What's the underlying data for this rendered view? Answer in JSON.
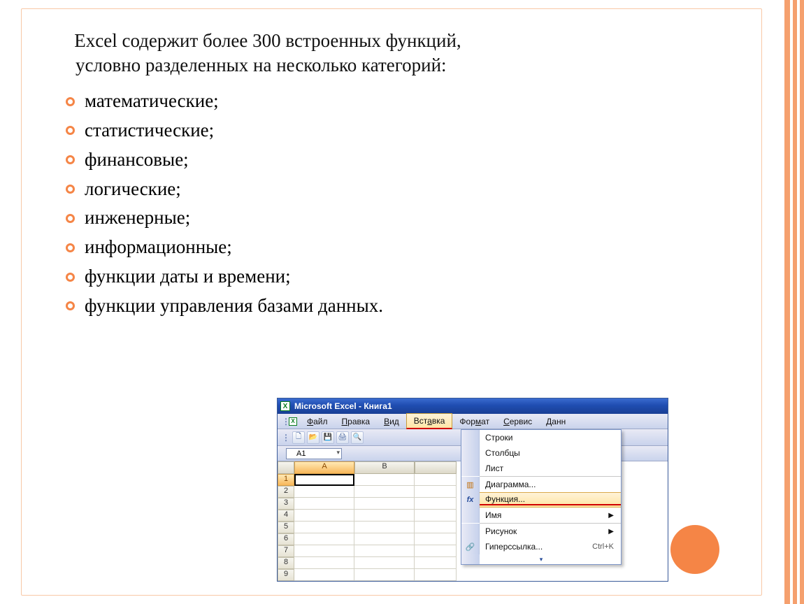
{
  "intro": {
    "line1": "Excel содержит более 300 встроенных функций,",
    "line2": "условно разделенных на несколько категорий:"
  },
  "categories": [
    "математические;",
    "статистические;",
    "финансовые;",
    "логические;",
    "инженерные;",
    "информационные;",
    "функции даты и времени;",
    "функции управления базами данных."
  ],
  "excel": {
    "title": "Microsoft Excel - Книга1",
    "menubar": {
      "file": "Файл",
      "edit": "Правка",
      "view": "Вид",
      "insert": "Вставка",
      "format": "Формат",
      "tools": "Сервис",
      "data": "Данн"
    },
    "namebox": "A1",
    "columns": [
      "A",
      "B"
    ],
    "row_numbers": [
      "1",
      "2",
      "3",
      "4",
      "5",
      "6",
      "7",
      "8",
      "9"
    ],
    "dropdown": {
      "rows": "Строки",
      "cols": "Столбцы",
      "sheet": "Лист",
      "chart": "Диаграмма...",
      "func": "Функция...",
      "name": "Имя",
      "pic": "Рисунок",
      "hyper": "Гиперссылка...",
      "hyper_short": "Ctrl+K",
      "fx": "fx"
    }
  }
}
